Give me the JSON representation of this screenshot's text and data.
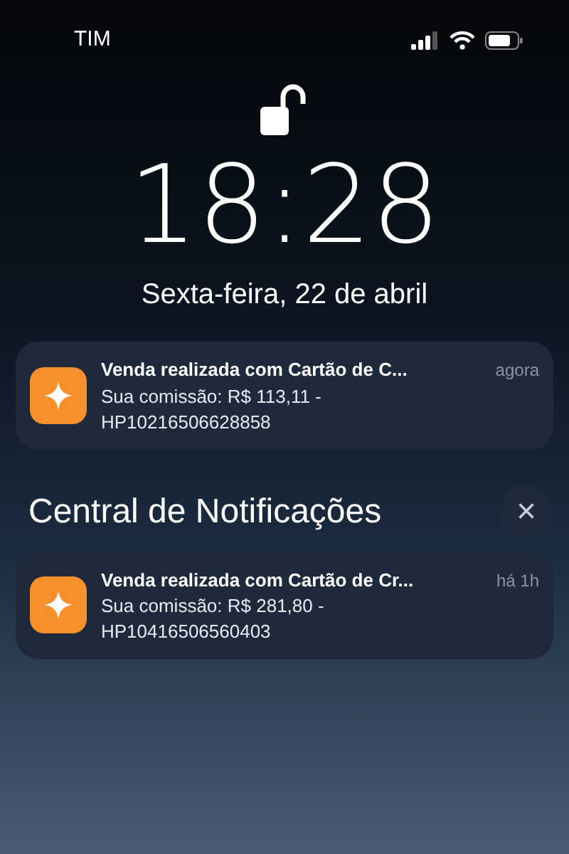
{
  "status_bar": {
    "carrier": "TIM"
  },
  "lock_screen": {
    "time": "18:28",
    "date": "Sexta-feira, 22 de abril"
  },
  "recent_notifications": [
    {
      "title": "Venda realizada com Cartão de C...",
      "time": "agora",
      "body_lines": [
        "Sua comissão: R$ 113,11 -",
        "HP10216506628858"
      ]
    }
  ],
  "notification_center": {
    "title": "Central de Notificações",
    "close_label": "×",
    "notifications": [
      {
        "title": "Venda realizada com Cartão de Cr...",
        "time": "há 1h",
        "body_lines": [
          "Sua comissão: R$ 281,80 -",
          "HP10416506560403"
        ]
      }
    ]
  }
}
